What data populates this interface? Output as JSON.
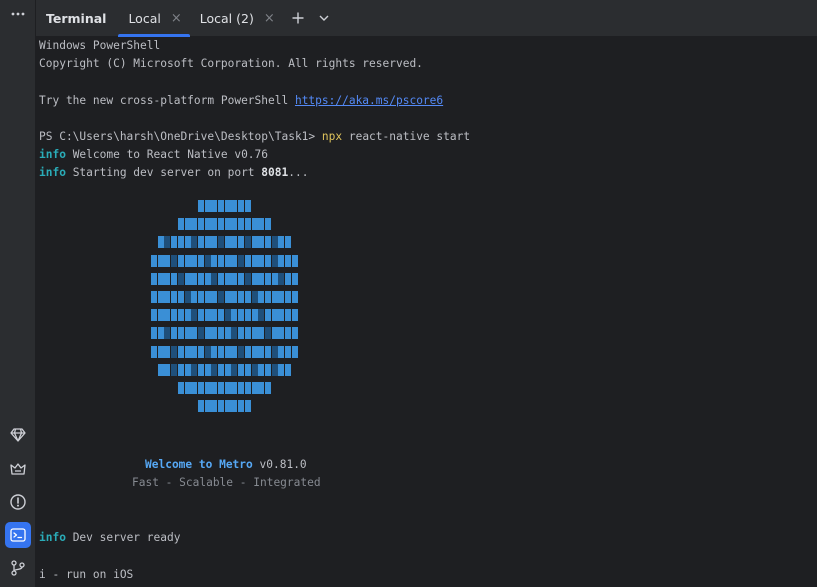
{
  "header": {
    "title": "Terminal",
    "tabs": [
      {
        "label": "Local",
        "active": true
      },
      {
        "label": "Local (2)",
        "active": false
      }
    ],
    "close_glyph": "×"
  },
  "sidebar": {
    "icons": [
      "more-icon",
      "gem-icon",
      "deploy-icon",
      "problems-icon",
      "terminal-icon",
      "git-icon"
    ],
    "active": "terminal-icon"
  },
  "terminal": {
    "l1": "Windows PowerShell",
    "l2": "Copyright (C) Microsoft Corporation. All rights reserved.",
    "l3_prefix": "Try the new cross-platform PowerShell ",
    "l3_link": "https://aka.ms/pscore6",
    "prompt": "PS C:\\Users\\harsh\\OneDrive\\Desktop\\Task1> ",
    "cmd_npx": "npx",
    "cmd_rest": " react-native start",
    "info_tag": "info",
    "welcome_rn": " Welcome to React Native v0.76",
    "starting_pre": " Starting dev server on port ",
    "port": "8081",
    "starting_post": "...",
    "metro_welcome": "Welcome to Metro",
    "metro_version": " v0.81.0",
    "metro_tagline": "Fast - Scalable - Integrated",
    "ready": " Dev server ready",
    "run_ios": "i - run on iOS"
  },
  "colors": {
    "accent": "#3574f0",
    "info": "#2aacb8",
    "npx": "#e0c45c",
    "link": "#548af7",
    "metro": "#56a8f5"
  }
}
